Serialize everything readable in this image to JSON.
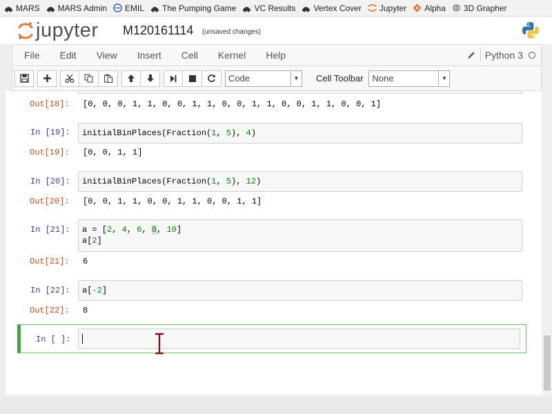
{
  "bookmarks": [
    {
      "label": "MARS",
      "icon": "mars-icon"
    },
    {
      "label": "MARS Admin",
      "icon": "mars-icon"
    },
    {
      "label": "EMIL",
      "icon": "emil-icon"
    },
    {
      "label": "The Pumping Game",
      "icon": "mars-icon"
    },
    {
      "label": "VC Results",
      "icon": "mars-icon"
    },
    {
      "label": "Vertex Cover",
      "icon": "mars-icon"
    },
    {
      "label": "Jupyter",
      "icon": "jupyter-icon"
    },
    {
      "label": "Alpha",
      "icon": "gear-icon"
    },
    {
      "label": "3D Grapher",
      "icon": "globe-icon"
    }
  ],
  "header": {
    "logo_text": "jupyter",
    "notebook_name": "M120161114",
    "save_status": "(unsaved changes)"
  },
  "menu": {
    "items": [
      "File",
      "Edit",
      "View",
      "Insert",
      "Cell",
      "Kernel",
      "Help"
    ],
    "kernel_name": "Python 3"
  },
  "toolbar": {
    "cell_type": "Code",
    "cell_toolbar_label": "Cell Toolbar",
    "cell_toolbar_value": "None"
  },
  "cells": {
    "c18": {
      "out_prompt": "Out[18]:",
      "output": "[0, 0, 0, 1, 1, 0, 0, 1, 1, 0, 0, 1, 1, 0, 0, 1, 1, 0, 0, 1]"
    },
    "c19": {
      "in_prompt": "In [19]:",
      "code_fn": "initialBinPlaces(Fraction(",
      "code_a": "1",
      "code_sep": ", ",
      "code_b": "5",
      "code_mid": "), ",
      "code_c": "4",
      "code_end": ")",
      "out_prompt": "Out[19]:",
      "output": "[0, 0, 1, 1]"
    },
    "c20": {
      "in_prompt": "In [20]:",
      "code_fn": "initialBinPlaces(Fraction(",
      "code_a": "1",
      "code_sep": ", ",
      "code_b": "5",
      "code_mid": "), ",
      "code_c": "12",
      "code_end": ")",
      "out_prompt": "Out[20]:",
      "output": "[0, 0, 1, 1, 0, 0, 1, 1, 0, 0, 1, 1]"
    },
    "c21": {
      "in_prompt": "In [21]:",
      "line1_head": "a = [",
      "n1": "2",
      "n2": "4",
      "n3": "6",
      "n4": "8",
      "n5": "10",
      "line1_tail": "]",
      "line2_head": "a[",
      "line2_idx": "2",
      "line2_tail": "]",
      "out_prompt": "Out[21]:",
      "output": "6"
    },
    "c22": {
      "in_prompt": "In [22]:",
      "code_head": "a[",
      "code_idx": "-2",
      "code_tail": "]",
      "out_prompt": "Out[22]:",
      "output": "8"
    },
    "c23": {
      "in_prompt": "In [ ]:"
    }
  },
  "colors": {
    "accent_green": "#42a545",
    "in_prompt": "#303f9f",
    "out_prompt": "#d84315",
    "number": "#008800"
  }
}
